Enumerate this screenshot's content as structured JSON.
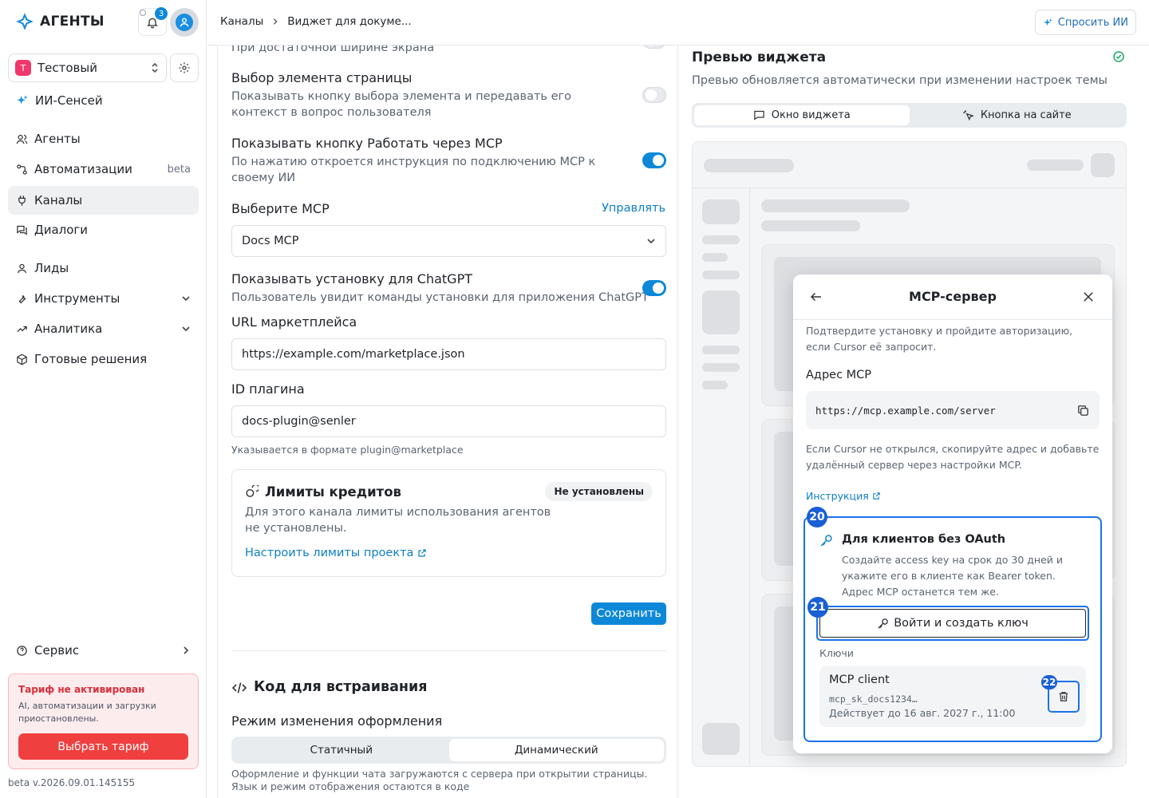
{
  "app": {
    "name": "АГЕНТЫ",
    "notifications": "3"
  },
  "project": {
    "initial": "Т",
    "name": "Тестовый"
  },
  "nav": {
    "ai": "ИИ-Сенсей",
    "agents": "Агенты",
    "automations": "Автоматизации",
    "automations_badge": "beta",
    "channels": "Каналы",
    "dialogs": "Диалоги",
    "leads": "Лиды",
    "tools": "Инструменты",
    "analytics": "Аналитика",
    "solutions": "Готовые решения",
    "service": "Сервис"
  },
  "tariff": {
    "title": "Тариф не активирован",
    "text": "AI, автоматизации и загрузки приостановлены.",
    "button": "Выбрать тариф"
  },
  "version": "beta v.2026.09.01.145155",
  "header": {
    "crumb1": "Каналы",
    "crumb2": "Виджет для докуме...",
    "ask": "Спросить ИИ"
  },
  "form": {
    "top_cut": "При достаточной ширине экрана",
    "pick_title": "Выбор элемента страницы",
    "pick_desc": "Показывать кнопку выбора элемента и передавать его контекст в вопрос пользователя",
    "mcp_btn_title": "Показывать кнопку Работать через MCP",
    "mcp_btn_desc": "По нажатию откроется инструкция по подключению MCP к своему ИИ",
    "choose_mcp": "Выберите MCP",
    "manage": "Управлять",
    "mcp_value": "Docs MCP",
    "chatgpt_title": "Показывать установку для ChatGPT",
    "chatgpt_desc": "Пользователь увидит команды установки для приложения ChatGPT",
    "market_label": "URL маркетплейса",
    "market_value": "https://example.com/marketplace.json",
    "plugin_label": "ID плагина",
    "plugin_value": "docs-plugin@senler",
    "plugin_hint": "Указывается в формате plugin@marketplace",
    "limits_title": "Лимиты кредитов",
    "limits_badge": "Не установлены",
    "limits_desc": "Для этого канала лимиты использования агентов не установлены.",
    "limits_link": "Настроить лимиты проекта",
    "save": "Сохранить",
    "embed_title": "Код для встраивания",
    "mode_title": "Режим изменения оформления",
    "mode_static": "Статичный",
    "mode_dynamic": "Динамический",
    "mode_desc": "Оформление и функции чата загружаются с сервера при открытии страницы. Язык и режим отображения остаются в коде"
  },
  "toggles": {
    "pick": false,
    "mcp": true,
    "chatgpt": true
  },
  "preview": {
    "title": "Превью виджета",
    "subtitle": "Превью обновляется автоматически при изменении настроек темы",
    "tab_window": "Окно виджета",
    "tab_button": "Кнопка на сайте"
  },
  "modal": {
    "title": "MCP-сервер",
    "confirm": "Подтвердите установку и пройдите авторизацию, если Cursor её запросит.",
    "addr_label": "Адрес MCP",
    "addr_value": "https://mcp.example.com/server",
    "fallback": "Если Cursor не открылся, скопируйте адрес и добавьте удалённый сервер через настройки MCP.",
    "instruction": "Инструкция",
    "oauth_title": "Для клиентов без OAuth",
    "oauth_desc": "Создайте access key на срок до 30 дней и укажите его в клиенте как Bearer token. Адрес MCP останется тем же.",
    "login_btn": "Войти и создать ключ",
    "keys_label": "Ключи",
    "key_name": "MCP client",
    "key_value": "mcp_sk_docs1234…",
    "key_expiry": "Действует до 16 авг. 2027 г., 11:00"
  },
  "markers": {
    "m20": "20",
    "m21": "21",
    "m22": "22"
  },
  "colors": {
    "accent": "#0d88d8",
    "danger": "#ef3f3f",
    "highlight": "#1a73e8"
  }
}
